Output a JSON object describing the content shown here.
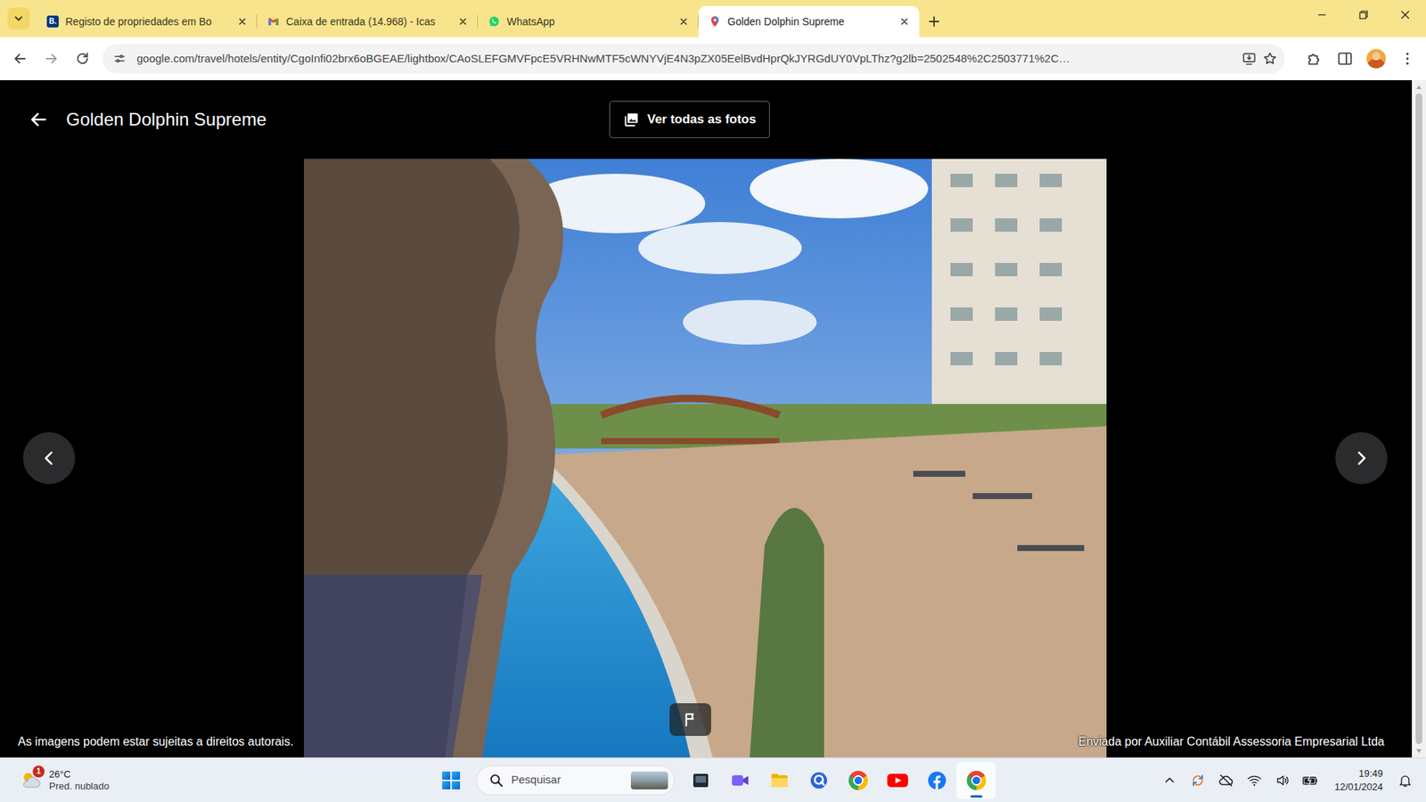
{
  "browser": {
    "tabs": [
      {
        "label": "Registo de propriedades em Bo",
        "selected": false,
        "kind": "booking",
        "icon_text": "B."
      },
      {
        "label": "Caixa de entrada (14.968) - Icas",
        "selected": false,
        "kind": "gmail"
      },
      {
        "label": "WhatsApp",
        "selected": false,
        "kind": "whatsapp"
      },
      {
        "label": "Golden Dolphin Supreme",
        "selected": true,
        "kind": "travel"
      }
    ],
    "address": "google.com/travel/hotels/entity/CgoInfi02brx6oBGEAE/lightbox/CAoSLEFGMVFpcE5VRHNwMTF5cWNYVjE4N3pZX05EelBvdHprQkJYRGdUY0VpLThz?g2lb=2502548%2C2503771%2C…"
  },
  "lightbox": {
    "title": "Golden Dolphin Supreme",
    "view_all": "Ver todas as fotos",
    "copyright": "As imagens podem estar sujeitas a direitos autorais.",
    "uploader": "Enviada por Auxiliar Contábil Assessoria Empresarial Ltda"
  },
  "taskbar": {
    "weather": {
      "badge": "1",
      "temp": "26°C",
      "condition": "Pred. nublado"
    },
    "search": "Pesquisar",
    "apps": [
      {
        "kind": "taskview",
        "selected": false
      },
      {
        "kind": "meet",
        "selected": false
      },
      {
        "kind": "explorer",
        "selected": false
      },
      {
        "kind": "circle",
        "selected": false
      },
      {
        "kind": "chrome",
        "selected": false
      },
      {
        "kind": "youtube",
        "selected": false
      },
      {
        "kind": "facebook",
        "selected": false
      },
      {
        "kind": "chrome",
        "selected": true
      }
    ],
    "clock": {
      "time": "19:49",
      "date": "12/01/2024"
    }
  }
}
